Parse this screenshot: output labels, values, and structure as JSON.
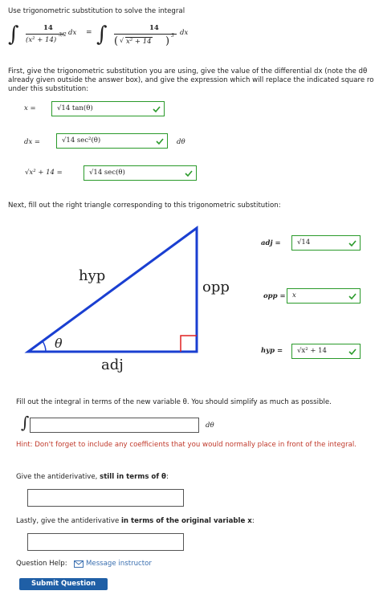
{
  "intro": "Use trigonometric substitution to solve the integral",
  "integral": {
    "num1": "14",
    "den1": "(x² + 14)",
    "exp1": "3/2",
    "num2": "14",
    "den2": "x² + 14",
    "exp2": "3",
    "dx": "dx"
  },
  "instructions": "First, give the trigonometric substitution you are using, give the value of the differential dx (note the dθ already given outside the answer box), and give the expression which will replace the indicated square ro under this substitution:",
  "substitution": {
    "x_label": "x =",
    "x_value": "√14 tan(θ)",
    "dx_label": "dx =",
    "dx_value": "√14 sec²(θ)",
    "dtheta": "dθ",
    "root_label": "√x² + 14 =",
    "root_value": "√14 sec(θ)"
  },
  "triangle_prompt": "Next, fill out the right triangle corresponding to this trigonometric substitution:",
  "triangle": {
    "hyp": "hyp",
    "opp": "opp",
    "adj": "adj",
    "theta": "θ"
  },
  "side_answers": {
    "adj_label": "adj =",
    "adj_value": "√14",
    "opp_label": "opp =",
    "opp_value": "x",
    "hyp_label": "hyp =",
    "hyp_value": "√x² + 14"
  },
  "integral_prompt": "Fill out the integral in terms of the new variable θ. You should simplify as much as possible.",
  "integral_answer": {
    "value": "",
    "dtheta": "dθ"
  },
  "hint": "Hint: Don't forget to include any coefficients that you would normally place in front of the integral.",
  "antideriv_prompt_pre": "Give the antiderivative, ",
  "antideriv_prompt_bold": "still in terms of θ",
  "antideriv_prompt_post": ":",
  "antideriv_value": "",
  "original_prompt_pre": "Lastly, give the antiderivative ",
  "original_prompt_bold": "in terms of the original variable x",
  "original_prompt_post": ":",
  "original_value": "",
  "help_label": "Question Help:",
  "message_link": "Message instructor",
  "submit_label": "Submit Question",
  "colors": {
    "correct": "#2a9a2a",
    "hint": "#c0392b",
    "triangle": "#1a3fd1",
    "button": "#1f5fa6"
  }
}
